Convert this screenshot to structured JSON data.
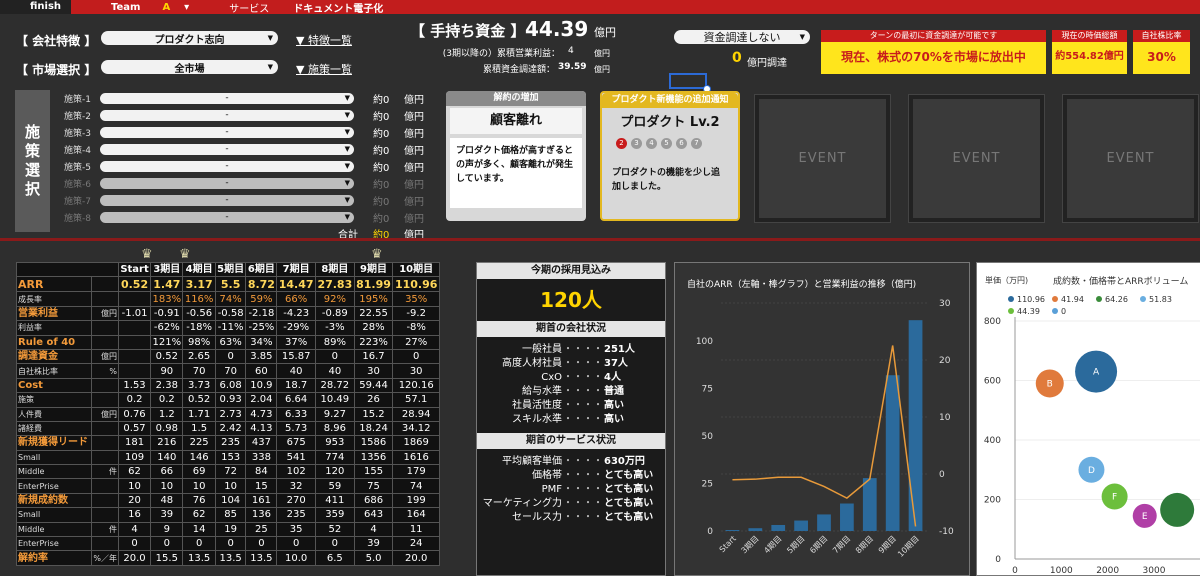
{
  "topbar": {
    "finish": "finish",
    "team_label": "Team",
    "team_value": "A",
    "team_arrow": "▾",
    "service_label": "サービス",
    "service_value": "ドキュメント電子化"
  },
  "company": {
    "label": "【 会社特徴 】",
    "value": "プロダクト志向",
    "link": "▼ 特徴一覧"
  },
  "market": {
    "label": "【 市場選択 】",
    "value": "全市場",
    "link": "▼ 施策一覧"
  },
  "funds": {
    "label": "【 手持ち資金 】",
    "value": "44.39",
    "unit": "億円",
    "note_label": "(3期以降の）累積営業利益：",
    "note_value": "4",
    "note_unit": "億円",
    "acc_label": "累積資金調達額：",
    "acc_value": "39.59",
    "acc_unit": "億円"
  },
  "raise": {
    "select": "資金調達しない",
    "value": "0",
    "unit": "億円調達"
  },
  "alert": {
    "head": "ターンの最初に資金調達が可能です",
    "body": "現在、株式の70%を市場に放出中"
  },
  "valuation": {
    "head": "現在の時価総額",
    "value": "約554.82億円"
  },
  "own": {
    "head": "自社株比率",
    "value": "30%"
  },
  "measures": {
    "side": [
      "施",
      "策",
      "選",
      "択"
    ],
    "items": [
      {
        "label": "施策-1",
        "value": "-",
        "amt": "約0",
        "unit": "億円"
      },
      {
        "label": "施策-2",
        "value": "-",
        "amt": "約0",
        "unit": "億円"
      },
      {
        "label": "施策-3",
        "value": "-",
        "amt": "約0",
        "unit": "億円"
      },
      {
        "label": "施策-4",
        "value": "-",
        "amt": "約0",
        "unit": "億円"
      },
      {
        "label": "施策-5",
        "value": "-",
        "amt": "約0",
        "unit": "億円"
      },
      {
        "label": "施策-6",
        "value": "-",
        "amt": "約0",
        "unit": "億円"
      },
      {
        "label": "施策-7",
        "value": "-",
        "amt": "約0",
        "unit": "億円"
      },
      {
        "label": "施策-8",
        "value": "-",
        "amt": "約0",
        "unit": "億円"
      }
    ],
    "total_label": "合計",
    "total_amt": "約0",
    "total_unit": "億円"
  },
  "card1": {
    "head": "解約の増加",
    "title": "顧客離れ",
    "desc": "プロダクト価格が高すぎるとの声が多く、顧客離れが発生しています。"
  },
  "card2": {
    "head": "プロダクト新機能の追加通知",
    "title": "プロダクト Lv.2",
    "dots": [
      "2",
      "3",
      "4",
      "5",
      "6",
      "7"
    ],
    "desc": "プロダクトの機能を少し追加しました。"
  },
  "events": [
    "EVENT",
    "EVENT",
    "EVENT"
  ],
  "table": {
    "headers": [
      "Start",
      "3期目",
      "4期目",
      "5期目",
      "6期目",
      "7期目",
      "8期目",
      "9期目",
      "10期目"
    ],
    "arr_label": "ARR",
    "arr": [
      "0.52",
      "1.47",
      "3.17",
      "5.5",
      "8.72",
      "14.47",
      "27.83",
      "81.99",
      "110.96"
    ],
    "growth_label": "成長率",
    "growth": [
      "",
      "183%",
      "116%",
      "74%",
      "59%",
      "66%",
      "92%",
      "195%",
      "35%"
    ],
    "op_label": "営業利益",
    "op_unit1": "億円",
    "op": [
      "-1.01",
      "-0.91",
      "-0.56",
      "-0.58",
      "-2.18",
      "-4.23",
      "-0.89",
      "22.55",
      "-9.2"
    ],
    "op_unit2": "利益率",
    "opr": [
      "",
      "-62%",
      "-18%",
      "-11%",
      "-25%",
      "-29%",
      "-3%",
      "28%",
      "-8%"
    ],
    "r40_label": "Rule of 40",
    "r40": [
      "",
      "121%",
      "98%",
      "63%",
      "34%",
      "37%",
      "89%",
      "223%",
      "27%"
    ],
    "fund_label": "調達資金",
    "fund_unit": "億円",
    "fund": [
      "",
      "0.52",
      "2.65",
      "0",
      "3.85",
      "15.87",
      "0",
      "16.7",
      "0"
    ],
    "own_label": "自社株比率",
    "own_unit": "%",
    "own": [
      "",
      "90",
      "70",
      "70",
      "60",
      "40",
      "40",
      "30",
      "30"
    ],
    "cost_label": "Cost",
    "cost": [
      "1.53",
      "2.38",
      "3.73",
      "6.08",
      "10.9",
      "18.7",
      "28.72",
      "59.44",
      "120.16"
    ],
    "c1_label": "施策",
    "c1": [
      "0.2",
      "0.2",
      "0.52",
      "0.93",
      "2.04",
      "6.64",
      "10.49",
      "26",
      "57.1"
    ],
    "c2_label": "人件費",
    "c2_unit": "億円",
    "c2": [
      "0.76",
      "1.2",
      "1.71",
      "2.73",
      "4.73",
      "6.33",
      "9.27",
      "15.2",
      "28.94"
    ],
    "c3_label": "諸経費",
    "c3": [
      "0.57",
      "0.98",
      "1.5",
      "2.42",
      "4.13",
      "5.73",
      "8.96",
      "18.24",
      "34.12"
    ],
    "lead_label": "新規獲得リード",
    "lead": [
      "181",
      "216",
      "225",
      "235",
      "437",
      "675",
      "953",
      "1586",
      "1869"
    ],
    "l1_label": "Small",
    "l1": [
      "109",
      "140",
      "146",
      "153",
      "338",
      "541",
      "774",
      "1356",
      "1616"
    ],
    "l2_label": "Middle",
    "l2_unit": "件",
    "l2": [
      "62",
      "66",
      "69",
      "72",
      "84",
      "102",
      "120",
      "155",
      "179"
    ],
    "l3_label": "EnterPrise",
    "l3": [
      "10",
      "10",
      "10",
      "10",
      "15",
      "32",
      "59",
      "75",
      "74"
    ],
    "won_label": "新規成約数",
    "won": [
      "20",
      "48",
      "76",
      "104",
      "161",
      "270",
      "411",
      "686",
      "199"
    ],
    "w1_label": "Small",
    "w1": [
      "16",
      "39",
      "62",
      "85",
      "136",
      "235",
      "359",
      "643",
      "164"
    ],
    "w2_label": "Middle",
    "w2_unit": "件",
    "w2": [
      "4",
      "9",
      "14",
      "19",
      "25",
      "35",
      "52",
      "4",
      "11"
    ],
    "w3_label": "EnterPrise",
    "w3": [
      "0",
      "0",
      "0",
      "0",
      "0",
      "0",
      "0",
      "39",
      "24"
    ],
    "churn_label": "解約率",
    "churn_unit": "%／年",
    "churn": [
      "20.0",
      "15.5",
      "13.5",
      "13.5",
      "13.5",
      "10.0",
      "6.5",
      "5.0",
      "20.0"
    ]
  },
  "hire": {
    "head": "今期の採用見込み",
    "value": "120人",
    "company_head": "期首の会社状況",
    "company": [
      {
        "k": "一般社員",
        "v": "251人"
      },
      {
        "k": "高度人材社員",
        "v": "37人"
      },
      {
        "k": "CxO",
        "v": "4人"
      },
      {
        "k": "給与水準",
        "v": "普通"
      },
      {
        "k": "社員活性度",
        "v": "高い"
      },
      {
        "k": "スキル水準",
        "v": "高い"
      }
    ],
    "dots": "・・・・",
    "service_head": "期首のサービス状況",
    "service": [
      {
        "k": "平均顧客単価",
        "v": "630万円"
      },
      {
        "k": "価格帯",
        "v": "とても高い"
      },
      {
        "k": "PMF",
        "v": "とても高い"
      },
      {
        "k": "マーケティング力",
        "v": "とても高い"
      },
      {
        "k": "セールス力",
        "v": "とても高い"
      }
    ]
  },
  "chart_data": [
    {
      "type": "bar",
      "title": "自社のARR（左軸・棒グラフ）と営業利益の推移（億円)",
      "categories": [
        "Start",
        "3期目",
        "4期目",
        "5期目",
        "6期目",
        "7期目",
        "8期目",
        "9期目",
        "10期目"
      ],
      "series": [
        {
          "values": [
            0.52,
            1.47,
            3.17,
            5.5,
            8.72,
            14.47,
            27.83,
            81.99,
            110.96
          ],
          "type": "bar",
          "color": "#2b6a9c"
        },
        {
          "values": [
            -1.01,
            -0.91,
            -0.56,
            -0.58,
            -2.18,
            -4.23,
            -0.89,
            22.55,
            -9.2
          ],
          "type": "line",
          "axis": "right",
          "color": "#e89a3a"
        }
      ],
      "yticks_left": [
        "0",
        "25",
        "50",
        "75",
        "100"
      ],
      "yticks_right": [
        "-10",
        "0",
        "10",
        "20",
        "30"
      ],
      "ylim": [
        0,
        120
      ],
      "ylim_right": [
        -10,
        30
      ]
    },
    {
      "type": "scatter",
      "title": "成約数・価格帯とARRボリューム",
      "ylabel": "単価（万円)",
      "legend": [
        {
          "name": "110.96",
          "color": "#2b6a9c"
        },
        {
          "name": "41.94",
          "color": "#e07a3c"
        },
        {
          "name": "64.26",
          "color": "#3a8c3a"
        },
        {
          "name": "51.83",
          "color": "#6aaee0"
        },
        {
          "name": "44.39",
          "color": "#6cbf3c"
        },
        {
          "name": "0",
          "color": "#5aa0d8"
        }
      ],
      "yticks": [
        "0",
        "200",
        "400",
        "600",
        "800"
      ],
      "xticks": [
        "0",
        "1000",
        "2000",
        "3000"
      ],
      "xlim": [
        0,
        3500
      ],
      "ylim": [
        0,
        800
      ],
      "points": [
        {
          "label": "A",
          "x": 1750,
          "y": 630,
          "r": 21,
          "color": "#2b6a9c"
        },
        {
          "label": "B",
          "x": 750,
          "y": 590,
          "r": 14,
          "color": "#e07a3c"
        },
        {
          "label": "D",
          "x": 1650,
          "y": 300,
          "r": 13,
          "color": "#6aaee0"
        },
        {
          "label": "F",
          "x": 2150,
          "y": 210,
          "r": 13,
          "color": "#6cbf3c"
        },
        {
          "label": "E",
          "x": 2800,
          "y": 145,
          "r": 12,
          "color": "#b03fa6"
        },
        {
          "label": "",
          "x": 3500,
          "y": 165,
          "r": 17,
          "color": "#2e7a3a"
        }
      ]
    }
  ]
}
